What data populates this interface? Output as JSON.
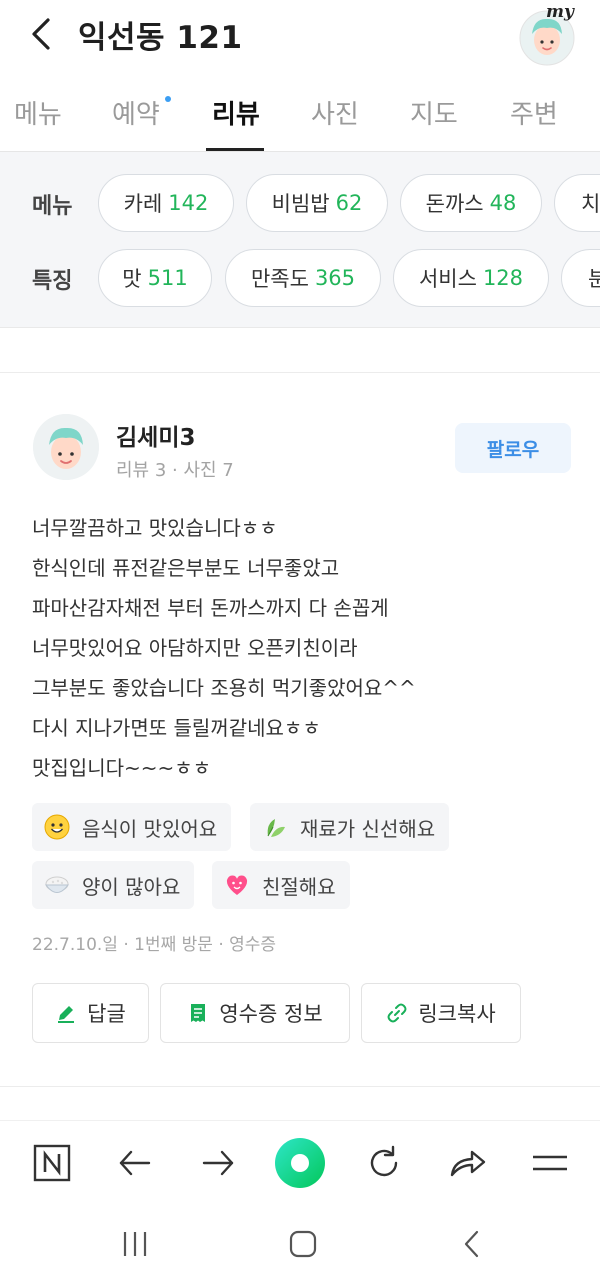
{
  "header": {
    "title": "익선동 121",
    "my_label": "my"
  },
  "tabs": [
    {
      "label": "메뉴",
      "active": false
    },
    {
      "label": "예약",
      "active": false,
      "dot": true
    },
    {
      "label": "리뷰",
      "active": true
    },
    {
      "label": "사진",
      "active": false
    },
    {
      "label": "지도",
      "active": false
    },
    {
      "label": "주변",
      "active": false
    }
  ],
  "filters": {
    "menu_label": "메뉴",
    "menu_chips": [
      {
        "name": "카레",
        "count": "142"
      },
      {
        "name": "비빔밥",
        "count": "62"
      },
      {
        "name": "돈까스",
        "count": "48"
      },
      {
        "name": "치",
        "count": ""
      }
    ],
    "feature_label": "특징",
    "feature_chips": [
      {
        "name": "맛",
        "count": "511"
      },
      {
        "name": "만족도",
        "count": "365"
      },
      {
        "name": "서비스",
        "count": "128"
      },
      {
        "name": "분",
        "count": ""
      }
    ]
  },
  "review": {
    "author": "김세미3",
    "meta": "리뷰 3 · 사진 7",
    "follow_label": "팔로우",
    "lines": [
      "너무깔끔하고 맛있습니다ㅎㅎ",
      "한식인데 퓨전같은부분도 너무좋았고",
      "파마산감자채전 부터 돈까스까지 다 손꼽게",
      "너무맛있어요 아담하지만 오픈키친이라",
      "그부분도 좋았습니다 조용히 먹기좋았어요^^",
      "다시 지나가면또 들릴꺼같네요ㅎㅎ",
      "맛집입니다~~~ㅎㅎ"
    ],
    "tags": [
      {
        "icon": "smiley-icon",
        "label": "음식이 맛있어요"
      },
      {
        "icon": "leaf-icon",
        "label": "재료가 신선해요"
      },
      {
        "icon": "rice-bowl-icon",
        "label": "양이 많아요"
      },
      {
        "icon": "heart-face-icon",
        "label": "친절해요"
      }
    ],
    "visit_meta": "22.7.10.일 · 1번째 방문 · 영수증",
    "actions": {
      "reply": "답글",
      "receipt": "영수증 정보",
      "copy_link": "링크복사"
    }
  },
  "colors": {
    "accent_green": "#22b55a",
    "follow_blue": "#3c8ee6",
    "naver_green": "#03c75a"
  }
}
